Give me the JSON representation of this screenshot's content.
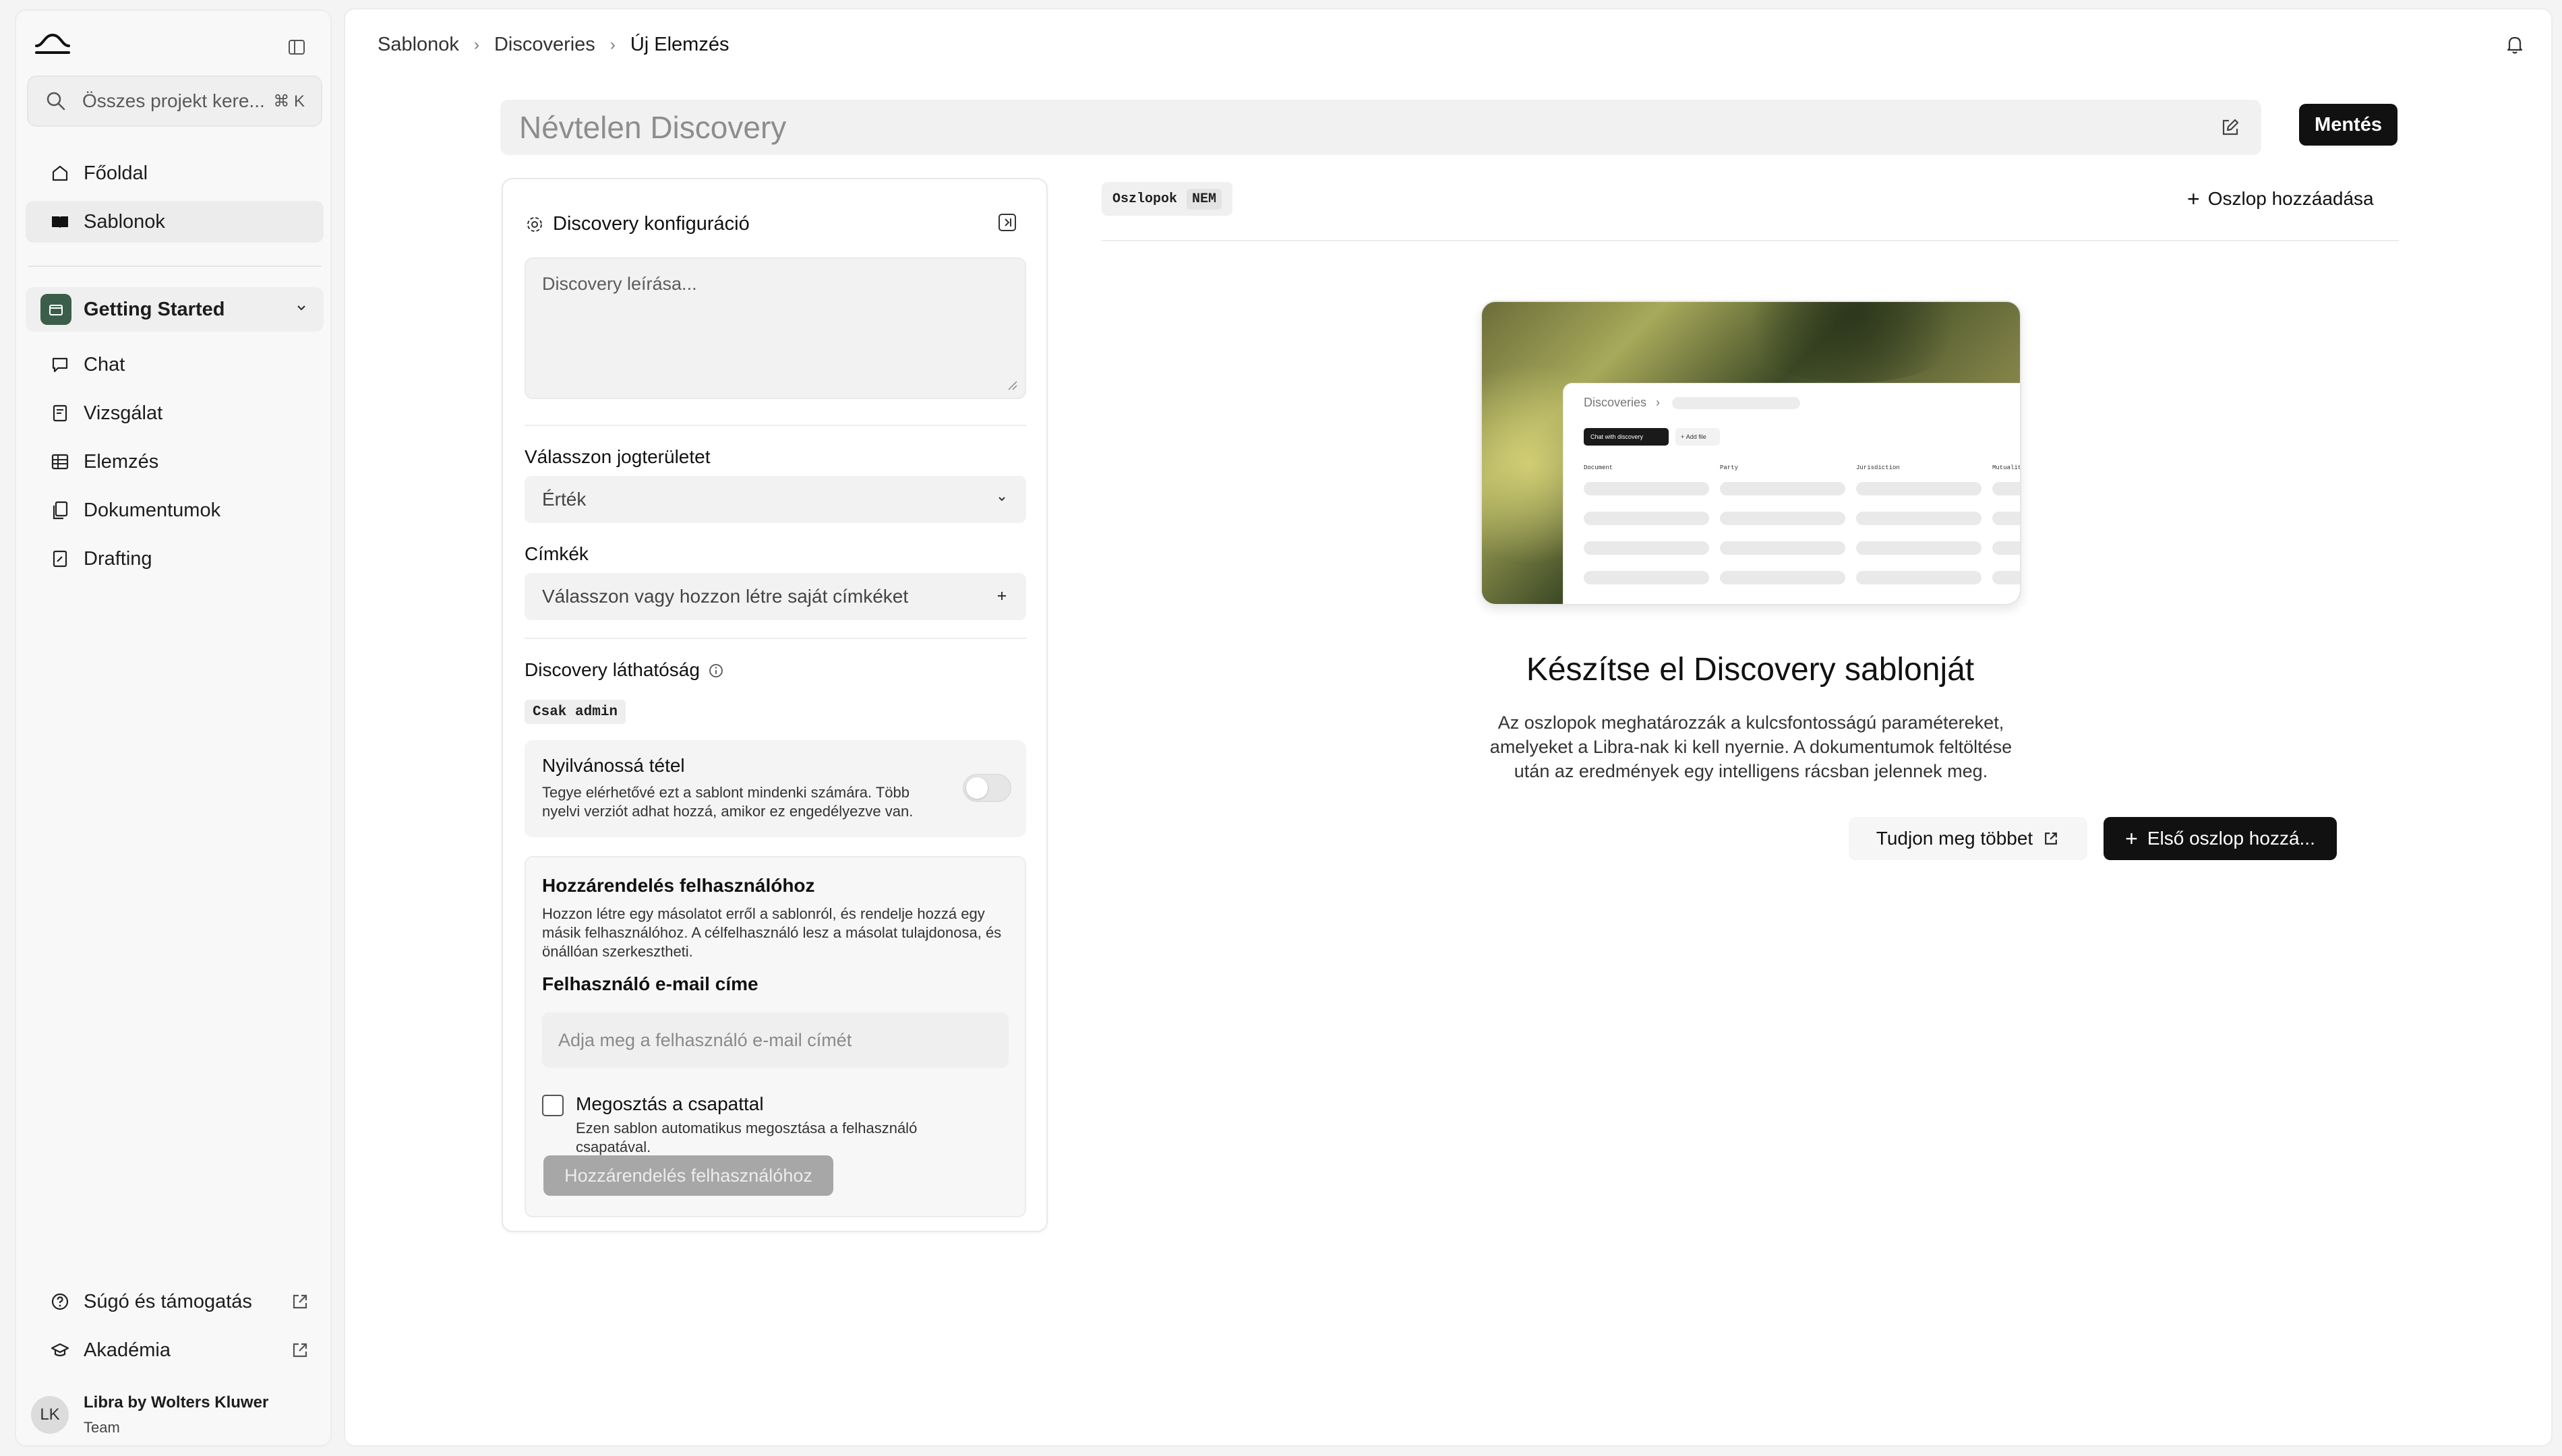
{
  "sidebar": {
    "search": {
      "placeholder": "Összes projekt kere...",
      "shortcut": "⌘ K"
    },
    "nav": [
      {
        "label": "Főoldal",
        "icon": "home-icon"
      },
      {
        "label": "Sablonok",
        "icon": "book-icon",
        "active": true
      }
    ],
    "project": {
      "label": "Getting Started"
    },
    "project_nav": [
      {
        "label": "Chat",
        "icon": "chat-icon"
      },
      {
        "label": "Vizsgálat",
        "icon": "document-search-icon"
      },
      {
        "label": "Elemzés",
        "icon": "table-icon"
      },
      {
        "label": "Dokumentumok",
        "icon": "documents-icon"
      },
      {
        "label": "Drafting",
        "icon": "draft-icon"
      }
    ],
    "footer": [
      {
        "label": "Súgó és támogatás",
        "icon": "help-icon"
      },
      {
        "label": "Akadémia",
        "icon": "academy-icon"
      }
    ],
    "user": {
      "initials": "LK",
      "name": "Libra by Wolters Kluwer",
      "team": "Team"
    }
  },
  "header": {
    "breadcrumb": [
      "Sablonok",
      "Discoveries",
      "Új Elemzés"
    ]
  },
  "title": {
    "placeholder": "Névtelen Discovery"
  },
  "toolbar": {
    "save_label": "Mentés"
  },
  "config": {
    "heading": "Discovery konfiguráció",
    "description_placeholder": "Discovery leírása...",
    "jurisdiction": {
      "label": "Válasszon jogterületet",
      "value": "Érték"
    },
    "tags": {
      "label": "Címkék",
      "placeholder": "Válasszon vagy hozzon létre saját címkéket"
    },
    "visibility": {
      "label": "Discovery láthatóság",
      "chip": "Csak admin",
      "public_title": "Nyilvánossá tétel",
      "public_text": "Tegye elérhetővé ezt a sablont mindenki számára. Több nyelvi verziót adhat hozzá, amikor ez engedélyezve van."
    },
    "assign": {
      "title": "Hozzárendelés felhasználóhoz",
      "text": "Hozzon létre egy másolatot erről a sablonról, és rendelje hozzá egy másik felhasználóhoz. A célfelhasználó lesz a másolat tulajdonosa, és önállóan szerkesztheti.",
      "email_label": "Felhasználó e-mail címe",
      "email_placeholder": "Adja meg a felhasználó e-mail címét",
      "share_title": "Megosztás a csapattal",
      "share_text": "Ezen sablon automatikus megosztása a felhasználó csapatával.",
      "button": "Hozzárendelés felhasználóhoz"
    }
  },
  "columns": {
    "chip_label": "Oszlopok",
    "chip_badge": "NEM",
    "add_label": "Oszlop hozzáadása"
  },
  "preview": {
    "crumb": "Discoveries",
    "chat_button": "Chat with discovery",
    "add_button": "Add file",
    "columns": [
      "Document",
      "Party",
      "Jurisdiction",
      "Mutuality"
    ]
  },
  "empty": {
    "title": "Készítse el Discovery sablonját",
    "text": "Az oszlopok meghatározzák a kulcsfontosságú paramétereket, amelyeket a Libra-nak ki kell nyernie. A dokumentumok feltöltése után az eredmények egy intelligens rácsban jelennek meg.",
    "learn_more": "Tudjon meg többet",
    "first_column": "Első oszlop hozzá..."
  },
  "colors": {
    "primary": "#111111",
    "project_badge": "#3b5e4b",
    "disabled_button": "#a7a7a7"
  }
}
